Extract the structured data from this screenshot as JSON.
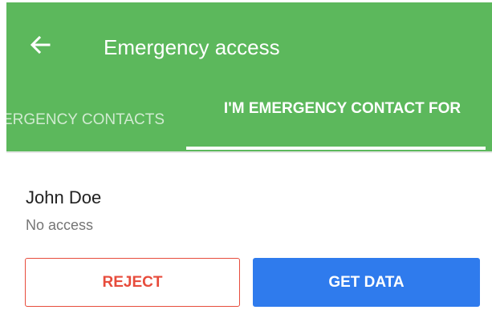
{
  "toolbar": {
    "back_icon": "arrow-left-icon",
    "title": "Emergency access"
  },
  "tabs": [
    {
      "label": "EMERGENCY CONTACTS",
      "selected": false
    },
    {
      "label": "I'M EMERGENCY CONTACT FOR",
      "selected": true
    }
  ],
  "contact": {
    "name": "John Doe",
    "status": "No access"
  },
  "actions": {
    "reject_label": "REJECT",
    "get_data_label": "GET DATA"
  },
  "colors": {
    "appbar": "#5cb85c",
    "reject": "#e74c3c",
    "primary": "#2f7bed"
  }
}
